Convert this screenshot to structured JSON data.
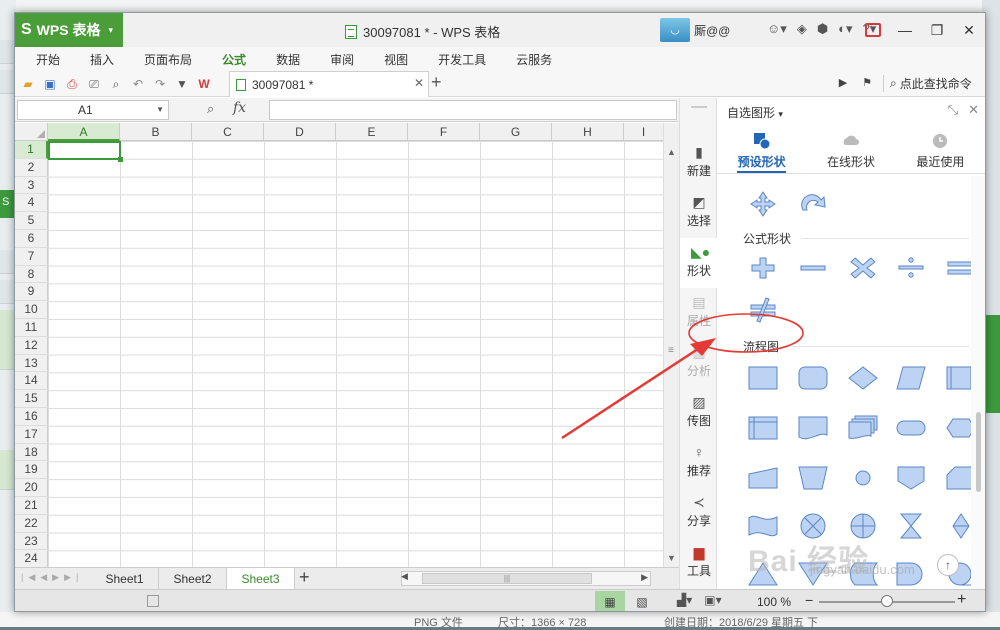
{
  "background": {
    "left_fragment": "S",
    "bottom_texts": [
      "PNG 文件",
      "尺寸：1366 × 728",
      "创建日期：2018/6/29 星期五 下"
    ]
  },
  "titlebar": {
    "app_name": "WPS 表格",
    "doc_title": "30097081 * - WPS 表格",
    "user_name": "厮@@"
  },
  "menu": [
    "开始",
    "插入",
    "页面布局",
    "公式",
    "数据",
    "审阅",
    "视图",
    "开发工具",
    "云服务"
  ],
  "menu_active": "公式",
  "toolbar": {
    "doc_tab": "30097081 *",
    "search_command": "点此查找命令"
  },
  "formula_bar": {
    "cell_ref": "A1",
    "fx": "fx",
    "value": ""
  },
  "grid": {
    "columns": [
      "A",
      "B",
      "C",
      "D",
      "E",
      "F",
      "G",
      "H",
      "I"
    ],
    "rows": [
      "1",
      "2",
      "3",
      "4",
      "5",
      "6",
      "7",
      "8",
      "9",
      "10",
      "11",
      "12",
      "13",
      "14",
      "15",
      "16",
      "17",
      "18",
      "19",
      "20",
      "21",
      "22",
      "23",
      "24"
    ],
    "selected_col": "A",
    "selected_row": "1"
  },
  "sheets": [
    "Sheet1",
    "Sheet2",
    "Sheet3"
  ],
  "active_sheet": "Sheet3",
  "statusbar": {
    "zoom": "100 %",
    "zoom_level": 0.5
  },
  "sidebar": [
    {
      "label": "新建",
      "icon": "new-doc-icon"
    },
    {
      "label": "选择",
      "icon": "select-icon"
    },
    {
      "label": "形状",
      "icon": "shapes-icon"
    },
    {
      "label": "属性",
      "icon": "properties-icon"
    },
    {
      "label": "分析",
      "icon": "analysis-icon"
    },
    {
      "label": "传图",
      "icon": "upload-image-icon"
    },
    {
      "label": "推荐",
      "icon": "recommend-icon"
    },
    {
      "label": "分享",
      "icon": "share-icon"
    },
    {
      "label": "工具",
      "icon": "toolbox-icon"
    }
  ],
  "pane": {
    "title": "自选图形",
    "tabs": [
      "预设形状",
      "在线形状",
      "最近使用"
    ],
    "active_tab": "预设形状",
    "sections": {
      "formula": "公式形状",
      "flowchart": "流程图"
    }
  },
  "colors": {
    "wps_green": "#4b9d3a",
    "shape_fill": "#bdd3f3",
    "shape_stroke": "#5b86c5",
    "annotation_red": "#e53935"
  },
  "watermark": {
    "main": "Bai 经验",
    "sub": "jingyan.baidu.com"
  }
}
